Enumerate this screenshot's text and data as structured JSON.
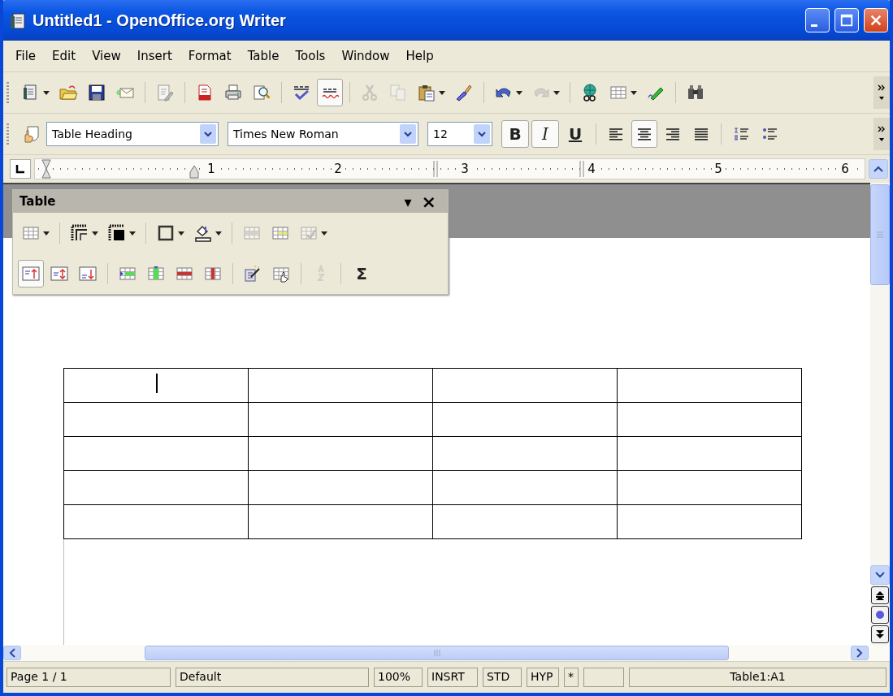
{
  "window": {
    "title": "Untitled1 - OpenOffice.org Writer"
  },
  "menu": [
    {
      "label": "File"
    },
    {
      "label": "Edit"
    },
    {
      "label": "View"
    },
    {
      "label": "Insert"
    },
    {
      "label": "Format"
    },
    {
      "label": "Table"
    },
    {
      "label": "Tools"
    },
    {
      "label": "Window"
    },
    {
      "label": "Help"
    }
  ],
  "standard_toolbar": [
    {
      "kind": "new",
      "dropdown": true,
      "selected": false,
      "disabled": false
    },
    {
      "kind": "open",
      "dropdown": false,
      "selected": false,
      "disabled": false
    },
    {
      "kind": "save",
      "dropdown": false,
      "selected": false,
      "disabled": false
    },
    {
      "kind": "mail",
      "dropdown": false,
      "selected": false,
      "disabled": false
    },
    {
      "kind": "separator"
    },
    {
      "kind": "edit",
      "dropdown": false,
      "selected": false,
      "disabled": false
    },
    {
      "kind": "separator"
    },
    {
      "kind": "pdf",
      "dropdown": false,
      "selected": false,
      "disabled": false
    },
    {
      "kind": "print",
      "dropdown": false,
      "selected": false,
      "disabled": false
    },
    {
      "kind": "preview",
      "dropdown": false,
      "selected": false,
      "disabled": false
    },
    {
      "kind": "separator"
    },
    {
      "kind": "spellcheck",
      "dropdown": false,
      "selected": false,
      "disabled": false
    },
    {
      "kind": "autospell",
      "dropdown": false,
      "selected": true,
      "disabled": false
    },
    {
      "kind": "separator"
    },
    {
      "kind": "cut",
      "dropdown": false,
      "selected": false,
      "disabled": true
    },
    {
      "kind": "copy",
      "dropdown": false,
      "selected": false,
      "disabled": true
    },
    {
      "kind": "paste",
      "dropdown": true,
      "selected": false,
      "disabled": false
    },
    {
      "kind": "brush",
      "dropdown": false,
      "selected": false,
      "disabled": false
    },
    {
      "kind": "separator"
    },
    {
      "kind": "undo",
      "dropdown": true,
      "selected": false,
      "disabled": false
    },
    {
      "kind": "redo",
      "dropdown": true,
      "selected": false,
      "disabled": true
    },
    {
      "kind": "separator"
    },
    {
      "kind": "navigator",
      "dropdown": false,
      "selected": false,
      "disabled": false
    },
    {
      "kind": "table",
      "dropdown": true,
      "selected": false,
      "disabled": false
    },
    {
      "kind": "draw",
      "dropdown": false,
      "selected": false,
      "disabled": false
    },
    {
      "kind": "separator"
    },
    {
      "kind": "find",
      "dropdown": false,
      "selected": false,
      "disabled": false
    }
  ],
  "formatting_toolbar": [
    {
      "kind": "stylist",
      "dropdown": false,
      "selected": false,
      "disabled": false
    },
    {
      "kind": "combo",
      "value": "Table Heading"
    },
    {
      "kind": "combo",
      "value": "Times New Roman"
    },
    {
      "kind": "combo",
      "value": "12"
    },
    {
      "kind": "bold",
      "label": "B",
      "selected": true
    },
    {
      "kind": "italic",
      "label": "I",
      "selected": true
    },
    {
      "kind": "underline",
      "label": "U",
      "selected": false
    },
    {
      "kind": "separator"
    },
    {
      "kind": "align-left",
      "dropdown": false,
      "selected": false,
      "disabled": false
    },
    {
      "kind": "align-center",
      "dropdown": false,
      "selected": true,
      "disabled": false
    },
    {
      "kind": "align-right",
      "dropdown": false,
      "selected": false,
      "disabled": false
    },
    {
      "kind": "justify",
      "dropdown": false,
      "selected": false,
      "disabled": false
    },
    {
      "kind": "separator"
    },
    {
      "kind": "numbering",
      "dropdown": false,
      "selected": false,
      "disabled": false
    },
    {
      "kind": "bullets",
      "dropdown": false,
      "selected": false,
      "disabled": false
    }
  ],
  "ruler": {
    "numbers": [
      "1",
      "2",
      "3",
      "4",
      "5",
      "6"
    ]
  },
  "table_toolbar": {
    "title": "Table",
    "menu_glyph": "▾",
    "close_glyph": "×",
    "rows": [
      [
        {
          "kind": "grid",
          "dropdown": true,
          "selected": false,
          "disabled": false
        },
        {
          "kind": "separator"
        },
        {
          "kind": "borders",
          "dropdown": true,
          "selected": false,
          "disabled": false
        },
        {
          "kind": "border-style",
          "dropdown": true,
          "selected": false,
          "disabled": false
        },
        {
          "kind": "separator"
        },
        {
          "kind": "border-color",
          "dropdown": true,
          "selected": false,
          "disabled": false
        },
        {
          "kind": "bucket",
          "dropdown": true,
          "selected": false,
          "disabled": false
        },
        {
          "kind": "separator"
        },
        {
          "kind": "merge",
          "dropdown": false,
          "selected": false,
          "disabled": true
        },
        {
          "kind": "split",
          "dropdown": false,
          "selected": false,
          "disabled": false
        },
        {
          "kind": "optimize",
          "dropdown": true,
          "selected": false,
          "disabled": true
        }
      ],
      [
        {
          "kind": "v-top",
          "dropdown": false,
          "selected": true,
          "disabled": false
        },
        {
          "kind": "v-center",
          "dropdown": false,
          "selected": false,
          "disabled": false
        },
        {
          "kind": "v-bottom",
          "dropdown": false,
          "selected": false,
          "disabled": false
        },
        {
          "kind": "separator"
        },
        {
          "kind": "insert-row",
          "dropdown": false,
          "selected": false,
          "disabled": false
        },
        {
          "kind": "insert-col",
          "dropdown": false,
          "selected": false,
          "disabled": false
        },
        {
          "kind": "delete-row",
          "dropdown": false,
          "selected": false,
          "disabled": false
        },
        {
          "kind": "delete-col",
          "dropdown": false,
          "selected": false,
          "disabled": false
        },
        {
          "kind": "separator"
        },
        {
          "kind": "autoformat",
          "dropdown": false,
          "selected": false,
          "disabled": false
        },
        {
          "kind": "table-props",
          "dropdown": false,
          "selected": false,
          "disabled": false
        },
        {
          "kind": "separator"
        },
        {
          "kind": "sort",
          "dropdown": false,
          "selected": false,
          "disabled": true
        },
        {
          "kind": "separator"
        },
        {
          "kind": "sum",
          "label": "Σ",
          "selected": false
        }
      ]
    ]
  },
  "document_table": {
    "rows": [
      {
        "cells": [
          {
            "cursor": true
          },
          {
            "cursor": false
          },
          {
            "cursor": false
          },
          {
            "cursor": false
          }
        ]
      },
      {
        "cells": [
          {
            "cursor": false
          },
          {
            "cursor": false
          },
          {
            "cursor": false
          },
          {
            "cursor": false
          }
        ]
      },
      {
        "cells": [
          {
            "cursor": false
          },
          {
            "cursor": false
          },
          {
            "cursor": false
          },
          {
            "cursor": false
          }
        ]
      },
      {
        "cells": [
          {
            "cursor": false
          },
          {
            "cursor": false
          },
          {
            "cursor": false
          },
          {
            "cursor": false
          }
        ]
      },
      {
        "cells": [
          {
            "cursor": false
          },
          {
            "cursor": false
          },
          {
            "cursor": false
          },
          {
            "cursor": false
          }
        ]
      }
    ]
  },
  "status_bar": [
    {
      "kind": "text",
      "text": "Page 1 / 1"
    },
    {
      "kind": "text",
      "text": "Default"
    },
    {
      "kind": "text",
      "text": "100%"
    },
    {
      "kind": "text",
      "text": "INSRT"
    },
    {
      "kind": "text",
      "text": "STD"
    },
    {
      "kind": "text",
      "text": "HYP"
    },
    {
      "kind": "text",
      "text": "*"
    },
    {
      "kind": "empty"
    },
    {
      "kind": "text",
      "text": "Table1:A1"
    }
  ]
}
